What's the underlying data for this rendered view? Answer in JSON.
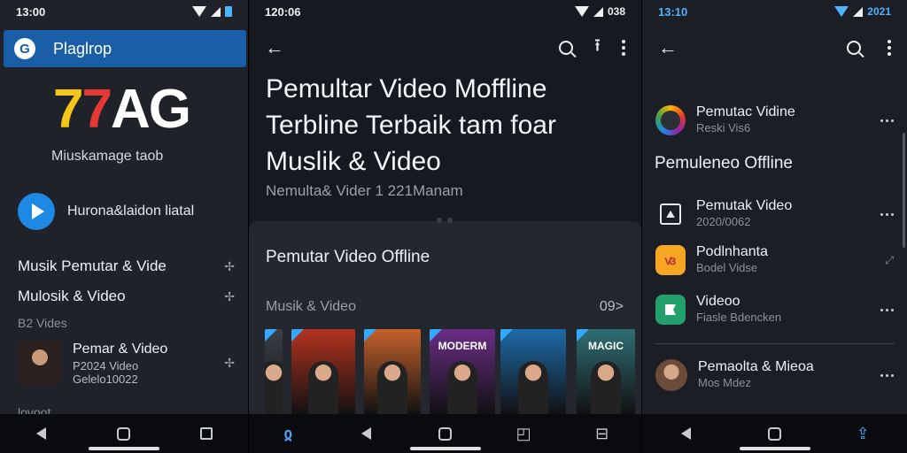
{
  "left": {
    "status_time": "13:00",
    "header_title": "Plaglrop",
    "header_logo_letter": "G",
    "big_logo": {
      "part1": "7",
      "part2": "7",
      "part3": "AG"
    },
    "subtitle": "Miuskamage taob",
    "play_label": "Hurona&laidon liatal",
    "items": [
      {
        "label": "Musik  Pemutar & Vide"
      },
      {
        "label": "Mulosik & Video"
      }
    ],
    "caption": "B2 Vides",
    "card": {
      "title": "Pemar & Video",
      "line2": "P2024 Video",
      "line3": "Gelelo10022"
    },
    "more_label": "lovoot",
    "nav": [
      "back",
      "home",
      "recents"
    ]
  },
  "middle": {
    "status_time": "120:06",
    "status_right": "038",
    "title": "Pemultar Video Moffline Terbline Terbaik tam foar Muslik & Video",
    "meta": "Nemulta& Vider 1 221Manam",
    "sheet_title": "Pemutar Video Offline",
    "section_label": "Musik & Video",
    "section_more": "09>",
    "thumbs": [
      {
        "label": "",
        "tone": "#3a3f49"
      },
      {
        "label": "",
        "tone": "#b3331f"
      },
      {
        "label": "",
        "tone": "#c4622c"
      },
      {
        "label": "MODERM",
        "tone": "#6a2d86"
      },
      {
        "label": "",
        "tone": "#1d6aa8"
      },
      {
        "label": "MAGIC",
        "tone": "#2f6f74"
      }
    ]
  },
  "right": {
    "status_time": "13:10",
    "status_right": "2021",
    "rows": [
      {
        "title": "Pemutac Vidine",
        "sub": "Reski Vis6",
        "icon": "gradient-app-icon"
      },
      {
        "title": "Pemutak Video",
        "sub": "2020/0062",
        "icon": "photo-frame-icon"
      },
      {
        "title": "Podlnhanta",
        "sub": "Bodel Vidse",
        "icon": "orange-app-icon"
      },
      {
        "title": "Videoo",
        "sub": "Fiasle Bdencken",
        "icon": "flag-app-icon"
      },
      {
        "title": "Pemaolta & Mieoa",
        "sub": "Mos Mdez",
        "icon": "avatar"
      }
    ],
    "section_title": "Pemuleneo Offline"
  }
}
